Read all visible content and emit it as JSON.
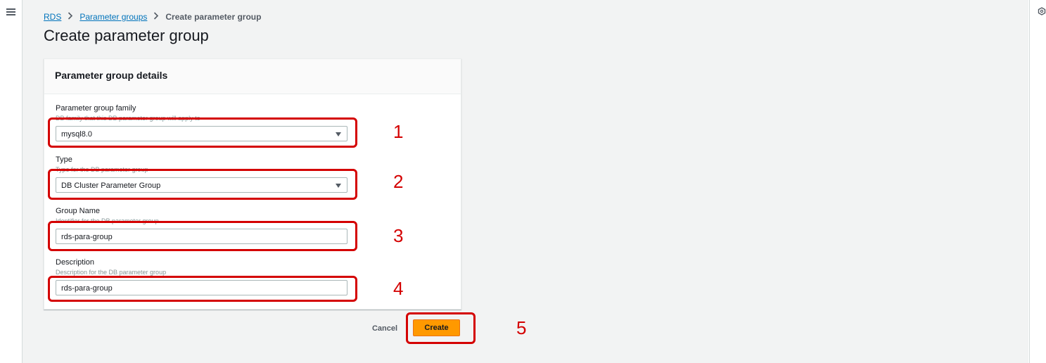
{
  "breadcrumb": {
    "items": [
      {
        "label": "RDS"
      },
      {
        "label": "Parameter groups"
      },
      {
        "label": "Create parameter group"
      }
    ]
  },
  "page": {
    "title": "Create parameter group"
  },
  "panel": {
    "title": "Parameter group details",
    "fields": [
      {
        "label": "Parameter group family",
        "description": "DB family that this DB parameter group will apply to",
        "value": "mysql8.0",
        "kind": "select"
      },
      {
        "label": "Type",
        "description": "Type for the DB parameter group",
        "value": "DB Cluster Parameter Group",
        "kind": "select"
      },
      {
        "label": "Group Name",
        "description": "Identifier for the DB parameter group",
        "value": "rds-para-group",
        "kind": "input"
      },
      {
        "label": "Description",
        "description": "Description for the DB parameter group",
        "value": "rds-para-group",
        "kind": "input"
      }
    ]
  },
  "actions": {
    "cancel_label": "Cancel",
    "create_label": "Create"
  },
  "annotations": {
    "numbers": [
      "1",
      "2",
      "3",
      "4",
      "5"
    ],
    "color": "#d40000"
  },
  "icons": {
    "menu": "hamburger-menu-icon",
    "settings": "settings-icon",
    "breadcrumb_sep": "chevron-right-icon",
    "select": "caret-down-icon"
  },
  "colors": {
    "primary_button": "#ff9900",
    "link": "#0073bb",
    "background": "#f2f3f3"
  }
}
